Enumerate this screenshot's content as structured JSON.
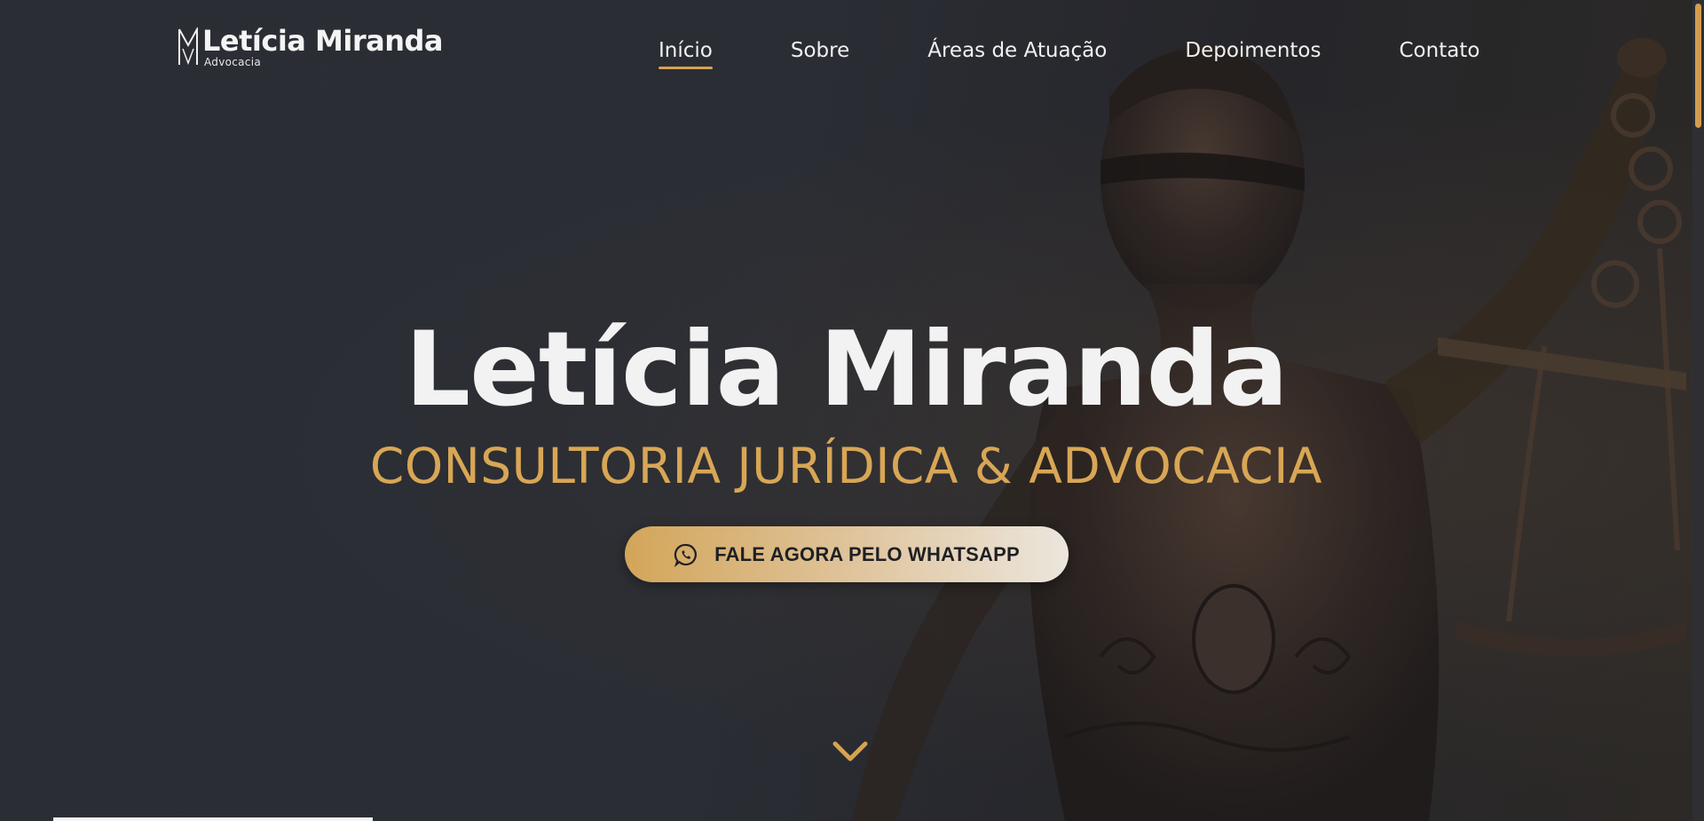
{
  "logo": {
    "mark_letters": "LM",
    "name": "Letícia Miranda",
    "subtitle": "Advocacia"
  },
  "nav": {
    "items": [
      {
        "label": "Início",
        "active": true
      },
      {
        "label": "Sobre",
        "active": false
      },
      {
        "label": "Áreas de Atuação",
        "active": false
      },
      {
        "label": "Depoimentos",
        "active": false
      },
      {
        "label": "Contato",
        "active": false
      }
    ]
  },
  "hero": {
    "title": "Letícia Miranda",
    "subtitle": "CONSULTORIA JURÍDICA & ADVOCACIA",
    "cta_label": "FALE AGORA PELO WHATSAPP",
    "cta_icon": "whatsapp-icon",
    "scroll_icon": "chevron-down-icon",
    "background_image": "lady-justice-statue"
  },
  "colors": {
    "accent": "#d7a24f",
    "background": "#2a2d33",
    "text": "#f2f2f2"
  }
}
